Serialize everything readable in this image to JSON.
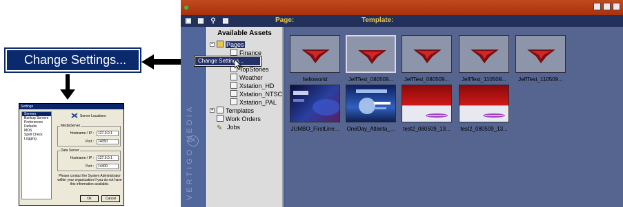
{
  "callout": {
    "label": "Change Settings..."
  },
  "settings_dialog": {
    "title": "Settings",
    "nav_items": [
      "Servers",
      "Backup Servers",
      "Preferences",
      "Defaults",
      "MOS",
      "Spell Check",
      "Logging"
    ],
    "selected_nav": "Servers",
    "heading": "Server Locations",
    "media_server": {
      "group_label": "MediaServer",
      "hostname_label": "Hostname / IP :",
      "hostname_value": "127.0.0.1",
      "port_label": "Port :",
      "port_value": "14050"
    },
    "data_server": {
      "group_label": "Data Server",
      "hostname_label": "Hostname / IP :",
      "hostname_value": "127.0.0.1",
      "port_label": "Port :",
      "port_value": "14400"
    },
    "note": "Please contact the System Administrator within your organization if you do not have this information available.",
    "ok_label": "Ok",
    "cancel_label": "Cancel"
  },
  "app": {
    "toolbar": {
      "page_label": "Page:",
      "template_label": "Template:"
    },
    "brand_text": "VERTIGO MEDIA",
    "tree": {
      "header": "Available Assets",
      "items": [
        {
          "label": "Pages",
          "icon": "pages-folder-icon",
          "selected": true
        },
        {
          "label": "Finance",
          "icon": "page-icon"
        },
        {
          "label": "TopStories",
          "icon": "page-icon"
        },
        {
          "label": "Weather",
          "icon": "page-icon"
        },
        {
          "label": "Xstation_HD",
          "icon": "page-icon"
        },
        {
          "label": "Xstation_NTSC",
          "icon": "page-icon"
        },
        {
          "label": "Xstation_PAL",
          "icon": "page-icon"
        },
        {
          "label": "Templates",
          "icon": "templates-icon"
        },
        {
          "label": "Work Orders",
          "icon": "work-orders-icon"
        },
        {
          "label": "Jobs",
          "icon": "pencil-icon"
        }
      ]
    },
    "context_menu": {
      "item": "Change Settings..."
    },
    "tiles": [
      {
        "label": "helloworld",
        "kind": "logo"
      },
      {
        "label": "JeffTest_080509...",
        "kind": "logo",
        "selected": true
      },
      {
        "label": "JeffTest_080509...",
        "kind": "logo"
      },
      {
        "label": "JeffTest_110509...",
        "kind": "logo"
      },
      {
        "label": "JeffTest_110509...",
        "kind": "logo"
      },
      {
        "label": "JUMBO_FirstLine...",
        "kind": "broadcast"
      },
      {
        "label": "OneDay_Atlanta_...",
        "kind": "broadcast"
      },
      {
        "label": "test2_080509_13...",
        "kind": "red"
      },
      {
        "label": "test2_080509_13...",
        "kind": "red"
      }
    ]
  }
}
